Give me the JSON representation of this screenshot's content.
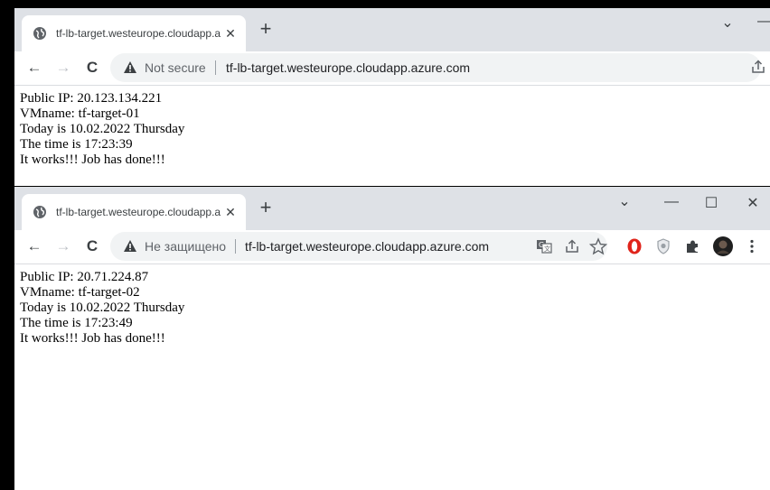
{
  "window1": {
    "tab_title": "tf-lb-target.westeurope.cloudapp.azure.com",
    "close_tab": "✕",
    "new_tab": "+",
    "minimize_chevron": "⌄",
    "security_label": "Not secure",
    "url": "tf-lb-target.westeurope.cloudapp.azure.com",
    "lines": [
      "Public IP: 20.123.134.221",
      "VMname: tf-target-01",
      "Today is 10.02.2022 Thursday",
      "The time is 17:23:39",
      "It works!!! Job has done!!!"
    ]
  },
  "window2": {
    "tab_title": "tf-lb-target.westeurope.cloudapp.azure.com",
    "close_tab": "✕",
    "new_tab": "+",
    "tab_search": "⌄",
    "minimize": "—",
    "maximize": "☐",
    "close": "✕",
    "security_label": "Не защищено",
    "url": "tf-lb-target.westeurope.cloudapp.azure.com",
    "lines": [
      "Public IP: 20.71.224.87",
      "VMname: tf-target-02",
      "Today is 10.02.2022 Thursday",
      "The time is 17:23:49",
      "It works!!! Job has done!!!"
    ]
  },
  "nav": {
    "back": "←",
    "forward": "→",
    "reload": "C"
  },
  "toolbar_icons": {
    "translate": "translate-icon",
    "share": "share-icon",
    "bookmark": "star-icon",
    "opera": "opera-icon",
    "shield": "shield-icon",
    "extensions": "puzzle-icon",
    "profile": "avatar",
    "menu": "more-icon"
  },
  "colors": {
    "tabstrip": "#dee1e6",
    "opera_red": "#e0241b",
    "frame": "#000000"
  }
}
